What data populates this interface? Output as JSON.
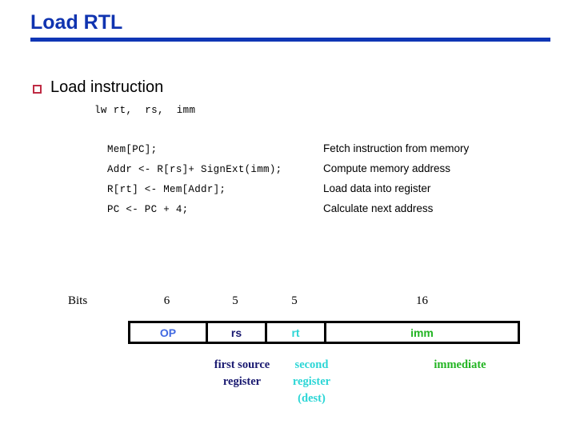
{
  "slide": {
    "title": "Load RTL",
    "accent_color": "#1034B0",
    "rule_color": "#0F36B5"
  },
  "bullet": {
    "marker": "hollow-square-bullet",
    "marker_color": "#BF2B44",
    "label": "Load instruction"
  },
  "instruction": {
    "syntax": "lw rt,  rs,  imm"
  },
  "rtl": {
    "rows": [
      {
        "code": "Mem[PC];",
        "description": "Fetch instruction from memory"
      },
      {
        "code": "Addr <- R[rs]+ SignExt(imm);",
        "description": "Compute memory address"
      },
      {
        "code": "R[rt] <- Mem[Addr];",
        "description": "Load data into register"
      },
      {
        "code": "PC <- PC + 4;",
        "description": "Calculate next address"
      }
    ]
  },
  "format": {
    "bits_label": "Bits",
    "bit_counts": [
      "6",
      "5",
      "5",
      "16"
    ],
    "fields": [
      {
        "name": "OP",
        "bits": "6",
        "color": "#4169E1"
      },
      {
        "name": "rs",
        "bits": "5",
        "color": "#191970"
      },
      {
        "name": "rt",
        "bits": "5",
        "color": "#2CD6D6"
      },
      {
        "name": "imm",
        "bits": "16",
        "color": "#22B422"
      }
    ],
    "notes": {
      "rs": "first source register",
      "rt": "second register (dest)",
      "imm": "immediate"
    }
  }
}
